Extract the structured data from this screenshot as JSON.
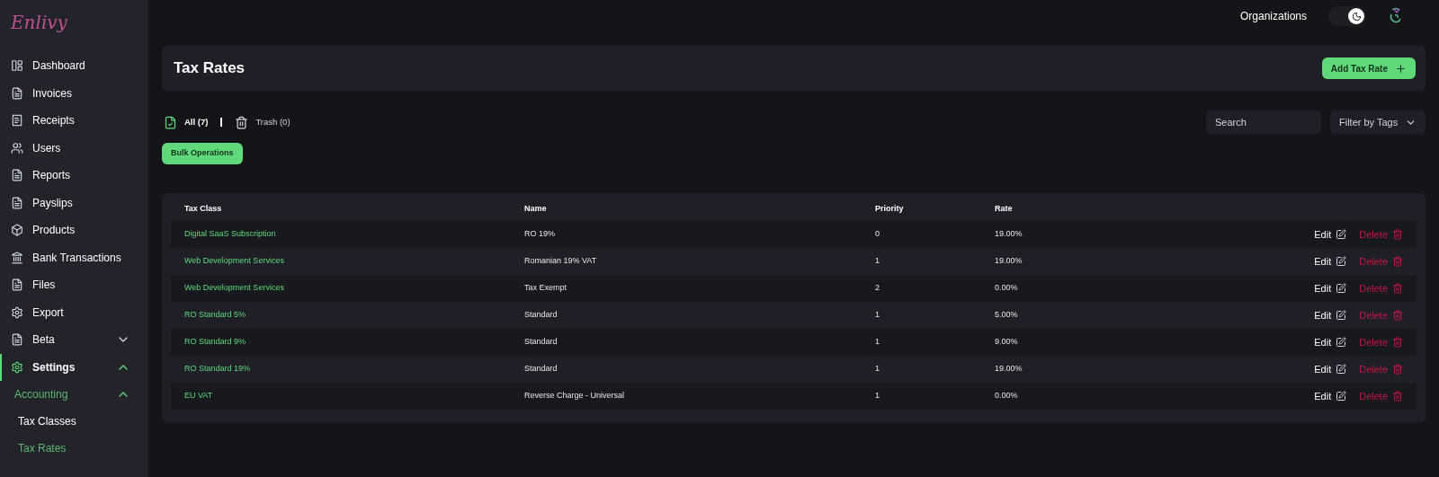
{
  "logo": "Enlivy",
  "sidebar": {
    "items": [
      {
        "label": "Dashboard",
        "kind": "layout",
        "selected": false
      },
      {
        "label": "Invoices",
        "kind": "file",
        "selected": false
      },
      {
        "label": "Receipts",
        "kind": "receipt",
        "selected": false
      },
      {
        "label": "Users",
        "kind": "users",
        "selected": false
      },
      {
        "label": "Reports",
        "kind": "file",
        "selected": false
      },
      {
        "label": "Payslips",
        "kind": "file",
        "selected": false
      },
      {
        "label": "Products",
        "kind": "box",
        "selected": false
      },
      {
        "label": "Bank Transactions",
        "kind": "bank",
        "selected": false
      },
      {
        "label": "Files",
        "kind": "file",
        "selected": false
      },
      {
        "label": "Export",
        "kind": "gear",
        "selected": false
      },
      {
        "label": "Beta",
        "kind": "file",
        "selected": false,
        "expanded": false
      },
      {
        "label": "Settings",
        "kind": "gear",
        "selected": true,
        "expanded": true,
        "children": [
          {
            "label": "Accounting",
            "selected": true,
            "expanded": true,
            "children": [
              {
                "label": "Tax Classes",
                "selected": false
              },
              {
                "label": "Tax Rates",
                "selected": true
              }
            ]
          }
        ]
      }
    ]
  },
  "topbar": {
    "organizations": "Organizations",
    "dark_mode": true
  },
  "header": {
    "title": "Tax Rates",
    "add_button": "Add Tax Rate"
  },
  "filters": [
    {
      "label": "All (7)",
      "kind": "all",
      "selected": true
    },
    {
      "label": "Trash (0)",
      "kind": "trash",
      "selected": false
    }
  ],
  "bulk_button": "Bulk Operations",
  "search": {
    "placeholder": "Search"
  },
  "tag_filter": "Filter by Tags",
  "table": {
    "columns": [
      "Tax Class",
      "Name",
      "Priority",
      "Rate"
    ],
    "rows": [
      {
        "cells": [
          "Digital SaaS Subscription",
          "RO 19%",
          "0",
          "19.00%"
        ],
        "edit": "Edit",
        "delete": "Delete"
      },
      {
        "cells": [
          "Web Development Services",
          "Romanian 19% VAT",
          "1",
          "19.00%"
        ],
        "edit": "Edit",
        "delete": "Delete"
      },
      {
        "cells": [
          "Web Development Services",
          "Tax Exempt",
          "2",
          "0.00%"
        ],
        "edit": "Edit",
        "delete": "Delete"
      },
      {
        "cells": [
          "RO Standard 5%",
          "Standard",
          "1",
          "5.00%"
        ],
        "edit": "Edit",
        "delete": "Delete"
      },
      {
        "cells": [
          "RO Standard 9%",
          "Standard",
          "1",
          "9.00%"
        ],
        "edit": "Edit",
        "delete": "Delete"
      },
      {
        "cells": [
          "RO Standard 19%",
          "Standard",
          "1",
          "19.00%"
        ],
        "edit": "Edit",
        "delete": "Delete"
      },
      {
        "cells": [
          "EU VAT",
          "Reverse Charge - Universal",
          "1",
          "0.00%"
        ],
        "edit": "Edit",
        "delete": "Delete"
      }
    ]
  }
}
